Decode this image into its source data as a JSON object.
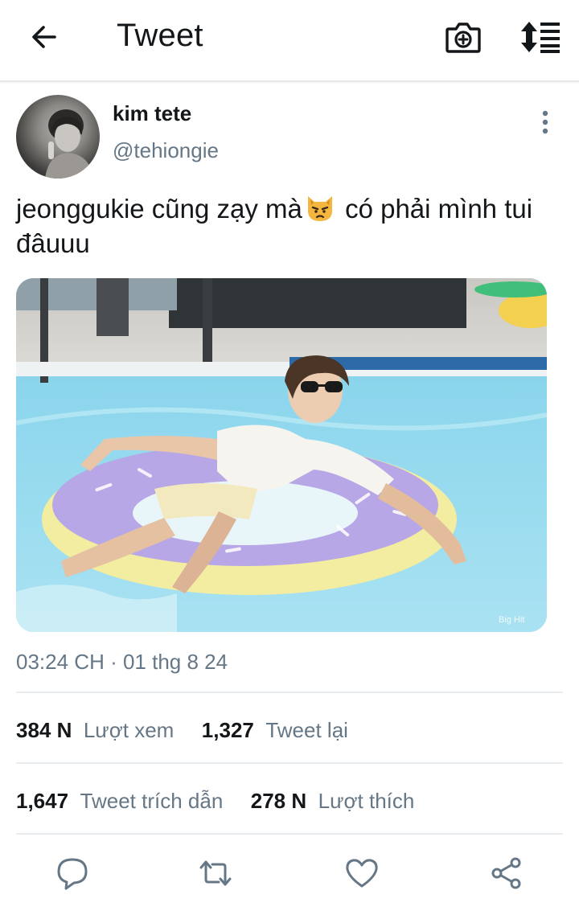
{
  "header": {
    "title": "Tweet",
    "back_icon": "back-arrow-icon",
    "camera_icon": "camera-add-icon",
    "sort_icon": "sort-icon"
  },
  "tweet": {
    "author_name": "kim tete",
    "author_handle": "@tehiongie",
    "text_part1": "jeonggukie cũng zạy mà",
    "emoji": "pouting-cat-emoji",
    "text_part2": " có phải mình tui đâuuu",
    "media_watermark": "Big Hit",
    "timestamp": "03:24 CH · 01 thg 8 24"
  },
  "stats": {
    "views_count": "384 N",
    "views_label": "Lượt xem",
    "retweets_count": "1,327",
    "retweets_label": "Tweet lại",
    "quotes_count": "1,647",
    "quotes_label": "Tweet trích dẫn",
    "likes_count": "278 N",
    "likes_label": "Lượt thích"
  },
  "colors": {
    "text": "#14171a",
    "secondary": "#657786",
    "divider": "#e6ecf0"
  }
}
